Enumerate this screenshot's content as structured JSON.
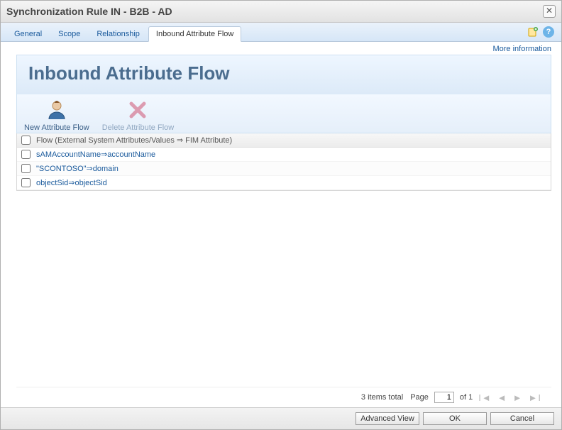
{
  "titlebar": {
    "title": "Synchronization Rule IN - B2B - AD"
  },
  "tabs": [
    {
      "label": "General"
    },
    {
      "label": "Scope"
    },
    {
      "label": "Relationship"
    },
    {
      "label": "Inbound Attribute Flow"
    }
  ],
  "info_link": "More information",
  "page": {
    "title": "Inbound Attribute Flow"
  },
  "toolbar": {
    "new_label": "New Attribute Flow",
    "delete_label": "Delete Attribute Flow"
  },
  "grid": {
    "header": "Flow (External System Attributes/Values ⇒ FIM Attribute)",
    "rows": [
      {
        "text": "sAMAccountName⇒accountName"
      },
      {
        "text": "\"SCONTOSO\"⇒domain"
      },
      {
        "text": "objectSid⇒objectSid"
      }
    ]
  },
  "pager": {
    "total_text": "3 items total",
    "page_label": "Page",
    "page_value": "1",
    "of_text": "of 1"
  },
  "footer": {
    "advanced": "Advanced View",
    "ok": "OK",
    "cancel": "Cancel"
  }
}
